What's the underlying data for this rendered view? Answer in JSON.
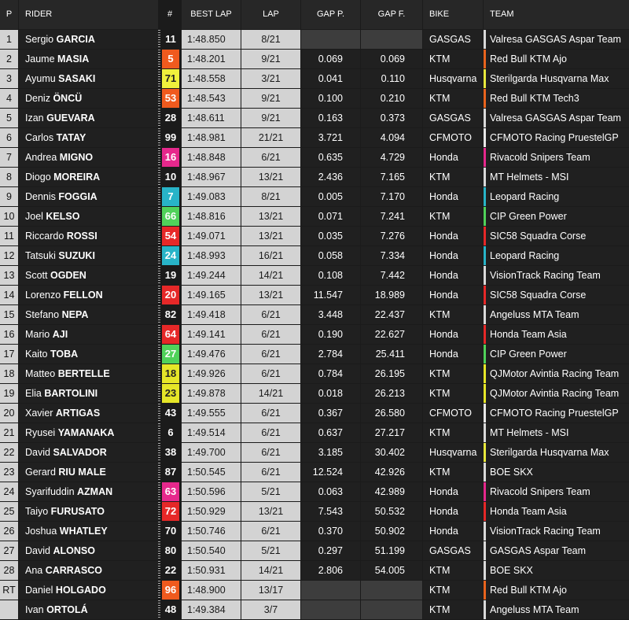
{
  "header": {
    "pos": "P",
    "rider": "RIDER",
    "num": "#",
    "best_lap": "BEST LAP",
    "lap": "LAP",
    "gap_p": "GAP P.",
    "gap_f": "GAP F.",
    "bike": "BIKE",
    "team": "TEAM"
  },
  "rows": [
    {
      "pos": "1",
      "first": "Sergio",
      "last": "GARCIA",
      "num": "11",
      "best": "1:48.850",
      "lap": "8/21",
      "gap_p": "",
      "gap_f": "",
      "bike": "GASGAS",
      "team": "Valresa GASGAS Aspar Team",
      "num_color": "#1b1b1b",
      "num_text": "#ffffff",
      "team_color": "#d9d9d9"
    },
    {
      "pos": "2",
      "first": "Jaume",
      "last": "MASIA",
      "num": "5",
      "best": "1:48.201",
      "lap": "9/21",
      "gap_p": "0.069",
      "gap_f": "0.069",
      "bike": "KTM",
      "team": "Red Bull KTM Ajo",
      "num_color": "#f05a1e",
      "num_text": "#ffffff",
      "team_color": "#e8641e"
    },
    {
      "pos": "3",
      "first": "Ayumu",
      "last": "SASAKI",
      "num": "71",
      "best": "1:48.558",
      "lap": "3/21",
      "gap_p": "0.041",
      "gap_f": "0.110",
      "bike": "Husqvarna",
      "team": "Sterilgarda Husqvarna Max",
      "num_color": "#f0f03c",
      "num_text": "#222222",
      "team_color": "#e8e83c"
    },
    {
      "pos": "4",
      "first": "Deniz",
      "last": "ÖNCÜ",
      "num": "53",
      "best": "1:48.543",
      "lap": "9/21",
      "gap_p": "0.100",
      "gap_f": "0.210",
      "bike": "KTM",
      "team": "Red Bull KTM Tech3",
      "num_color": "#f05a1e",
      "num_text": "#ffffff",
      "team_color": "#e8641e"
    },
    {
      "pos": "5",
      "first": "Izan",
      "last": "GUEVARA",
      "num": "28",
      "best": "1:48.611",
      "lap": "9/21",
      "gap_p": "0.163",
      "gap_f": "0.373",
      "bike": "GASGAS",
      "team": "Valresa GASGAS Aspar Team",
      "num_color": "#1b1b1b",
      "num_text": "#ffffff",
      "team_color": "#d9d9d9"
    },
    {
      "pos": "6",
      "first": "Carlos",
      "last": "TATAY",
      "num": "99",
      "best": "1:48.981",
      "lap": "21/21",
      "gap_p": "3.721",
      "gap_f": "4.094",
      "bike": "CFMOTO",
      "team": "CFMOTO Racing PruestelGP",
      "num_color": "#1b1b1b",
      "num_text": "#ffffff",
      "team_color": "#e8e8e8"
    },
    {
      "pos": "7",
      "first": "Andrea",
      "last": "MIGNO",
      "num": "16",
      "best": "1:48.848",
      "lap": "6/21",
      "gap_p": "0.635",
      "gap_f": "4.729",
      "bike": "Honda",
      "team": "Rivacold Snipers Team",
      "num_color": "#e6288c",
      "num_text": "#ffffff",
      "team_color": "#e6288c"
    },
    {
      "pos": "8",
      "first": "Diogo",
      "last": "MOREIRA",
      "num": "10",
      "best": "1:48.967",
      "lap": "13/21",
      "gap_p": "2.436",
      "gap_f": "7.165",
      "bike": "KTM",
      "team": "MT Helmets - MSI",
      "num_color": "#1b1b1b",
      "num_text": "#ffffff",
      "team_color": "#d9d9d9"
    },
    {
      "pos": "9",
      "first": "Dennis",
      "last": "FOGGIA",
      "num": "7",
      "best": "1:49.083",
      "lap": "8/21",
      "gap_p": "0.005",
      "gap_f": "7.170",
      "bike": "Honda",
      "team": "Leopard Racing",
      "num_color": "#28b4c8",
      "num_text": "#ffffff",
      "team_color": "#28b4c8"
    },
    {
      "pos": "10",
      "first": "Joel",
      "last": "KELSO",
      "num": "66",
      "best": "1:48.816",
      "lap": "13/21",
      "gap_p": "0.071",
      "gap_f": "7.241",
      "bike": "KTM",
      "team": "CIP Green Power",
      "num_color": "#50d25a",
      "num_text": "#ffffff",
      "team_color": "#50d25a"
    },
    {
      "pos": "11",
      "first": "Riccardo",
      "last": "ROSSI",
      "num": "54",
      "best": "1:49.071",
      "lap": "13/21",
      "gap_p": "0.035",
      "gap_f": "7.276",
      "bike": "Honda",
      "team": "SIC58 Squadra Corse",
      "num_color": "#e62828",
      "num_text": "#ffffff",
      "team_color": "#e62828"
    },
    {
      "pos": "12",
      "first": "Tatsuki",
      "last": "SUZUKI",
      "num": "24",
      "best": "1:48.993",
      "lap": "16/21",
      "gap_p": "0.058",
      "gap_f": "7.334",
      "bike": "Honda",
      "team": "Leopard Racing",
      "num_color": "#28b4c8",
      "num_text": "#ffffff",
      "team_color": "#28b4c8"
    },
    {
      "pos": "13",
      "first": "Scott",
      "last": "OGDEN",
      "num": "19",
      "best": "1:49.244",
      "lap": "14/21",
      "gap_p": "0.108",
      "gap_f": "7.442",
      "bike": "Honda",
      "team": "VisionTrack Racing Team",
      "num_color": "#1b1b1b",
      "num_text": "#ffffff",
      "team_color": "#d9d9d9"
    },
    {
      "pos": "14",
      "first": "Lorenzo",
      "last": "FELLON",
      "num": "20",
      "best": "1:49.165",
      "lap": "13/21",
      "gap_p": "11.547",
      "gap_f": "18.989",
      "bike": "Honda",
      "team": "SIC58 Squadra Corse",
      "num_color": "#e62828",
      "num_text": "#ffffff",
      "team_color": "#e62828"
    },
    {
      "pos": "15",
      "first": "Stefano",
      "last": "NEPA",
      "num": "82",
      "best": "1:49.418",
      "lap": "6/21",
      "gap_p": "3.448",
      "gap_f": "22.437",
      "bike": "KTM",
      "team": "Angeluss MTA Team",
      "num_color": "#1b1b1b",
      "num_text": "#ffffff",
      "team_color": "#d9d9d9"
    },
    {
      "pos": "16",
      "first": "Mario",
      "last": "AJI",
      "num": "64",
      "best": "1:49.141",
      "lap": "6/21",
      "gap_p": "0.190",
      "gap_f": "22.627",
      "bike": "Honda",
      "team": "Honda Team Asia",
      "num_color": "#e62828",
      "num_text": "#ffffff",
      "team_color": "#e62828"
    },
    {
      "pos": "17",
      "first": "Kaito",
      "last": "TOBA",
      "num": "27",
      "best": "1:49.476",
      "lap": "6/21",
      "gap_p": "2.784",
      "gap_f": "25.411",
      "bike": "Honda",
      "team": "CIP Green Power",
      "num_color": "#50d25a",
      "num_text": "#ffffff",
      "team_color": "#50d25a"
    },
    {
      "pos": "18",
      "first": "Matteo",
      "last": "BERTELLE",
      "num": "18",
      "best": "1:49.926",
      "lap": "6/21",
      "gap_p": "0.784",
      "gap_f": "26.195",
      "bike": "KTM",
      "team": "QJMotor Avintia Racing Team",
      "num_color": "#e6e628",
      "num_text": "#222222",
      "team_color": "#e6e628"
    },
    {
      "pos": "19",
      "first": "Elia",
      "last": "BARTOLINI",
      "num": "23",
      "best": "1:49.878",
      "lap": "14/21",
      "gap_p": "0.018",
      "gap_f": "26.213",
      "bike": "KTM",
      "team": "QJMotor Avintia Racing Team",
      "num_color": "#e6e628",
      "num_text": "#222222",
      "team_color": "#e6e628"
    },
    {
      "pos": "20",
      "first": "Xavier",
      "last": "ARTIGAS",
      "num": "43",
      "best": "1:49.555",
      "lap": "6/21",
      "gap_p": "0.367",
      "gap_f": "26.580",
      "bike": "CFMOTO",
      "team": "CFMOTO Racing PruestelGP",
      "num_color": "#1b1b1b",
      "num_text": "#ffffff",
      "team_color": "#e8e8e8"
    },
    {
      "pos": "21",
      "first": "Ryusei",
      "last": "YAMANAKA",
      "num": "6",
      "best": "1:49.514",
      "lap": "6/21",
      "gap_p": "0.637",
      "gap_f": "27.217",
      "bike": "KTM",
      "team": "MT Helmets - MSI",
      "num_color": "#1b1b1b",
      "num_text": "#ffffff",
      "team_color": "#d9d9d9"
    },
    {
      "pos": "22",
      "first": "David",
      "last": "SALVADOR",
      "num": "38",
      "best": "1:49.700",
      "lap": "6/21",
      "gap_p": "3.185",
      "gap_f": "30.402",
      "bike": "Husqvarna",
      "team": "Sterilgarda Husqvarna Max",
      "num_color": "#1b1b1b",
      "num_text": "#ffffff",
      "team_color": "#e8e83c"
    },
    {
      "pos": "23",
      "first": "Gerard",
      "last": "RIU MALE",
      "num": "87",
      "best": "1:50.545",
      "lap": "6/21",
      "gap_p": "12.524",
      "gap_f": "42.926",
      "bike": "KTM",
      "team": "BOE SKX",
      "num_color": "#1b1b1b",
      "num_text": "#ffffff",
      "team_color": "#d9d9d9"
    },
    {
      "pos": "24",
      "first": "Syarifuddin",
      "last": "AZMAN",
      "num": "63",
      "best": "1:50.596",
      "lap": "5/21",
      "gap_p": "0.063",
      "gap_f": "42.989",
      "bike": "Honda",
      "team": "Rivacold Snipers Team",
      "num_color": "#e6288c",
      "num_text": "#ffffff",
      "team_color": "#e6288c"
    },
    {
      "pos": "25",
      "first": "Taiyo",
      "last": "FURUSATO",
      "num": "72",
      "best": "1:50.929",
      "lap": "13/21",
      "gap_p": "7.543",
      "gap_f": "50.532",
      "bike": "Honda",
      "team": "Honda Team Asia",
      "num_color": "#e62828",
      "num_text": "#ffffff",
      "team_color": "#e62828"
    },
    {
      "pos": "26",
      "first": "Joshua",
      "last": "WHATLEY",
      "num": "70",
      "best": "1:50.746",
      "lap": "6/21",
      "gap_p": "0.370",
      "gap_f": "50.902",
      "bike": "Honda",
      "team": "VisionTrack Racing Team",
      "num_color": "#1b1b1b",
      "num_text": "#ffffff",
      "team_color": "#d9d9d9"
    },
    {
      "pos": "27",
      "first": "David",
      "last": "ALONSO",
      "num": "80",
      "best": "1:50.540",
      "lap": "5/21",
      "gap_p": "0.297",
      "gap_f": "51.199",
      "bike": "GASGAS",
      "team": "GASGAS Aspar Team",
      "num_color": "#1b1b1b",
      "num_text": "#ffffff",
      "team_color": "#d9d9d9"
    },
    {
      "pos": "28",
      "first": "Ana",
      "last": "CARRASCO",
      "num": "22",
      "best": "1:50.931",
      "lap": "14/21",
      "gap_p": "2.806",
      "gap_f": "54.005",
      "bike": "KTM",
      "team": "BOE SKX",
      "num_color": "#1b1b1b",
      "num_text": "#ffffff",
      "team_color": "#d9d9d9"
    },
    {
      "pos": "RT",
      "first": "Daniel",
      "last": "HOLGADO",
      "num": "96",
      "best": "1:48.900",
      "lap": "13/17",
      "gap_p": "",
      "gap_f": "",
      "bike": "KTM",
      "team": "Red Bull KTM Ajo",
      "num_color": "#f05a1e",
      "num_text": "#ffffff",
      "team_color": "#e8641e"
    },
    {
      "pos": "",
      "first": "Ivan",
      "last": "ORTOLÁ",
      "num": "48",
      "best": "1:49.384",
      "lap": "3/7",
      "gap_p": "",
      "gap_f": "",
      "bike": "KTM",
      "team": "Angeluss MTA Team",
      "num_color": "#1b1b1b",
      "num_text": "#ffffff",
      "team_color": "#d9d9d9"
    }
  ]
}
